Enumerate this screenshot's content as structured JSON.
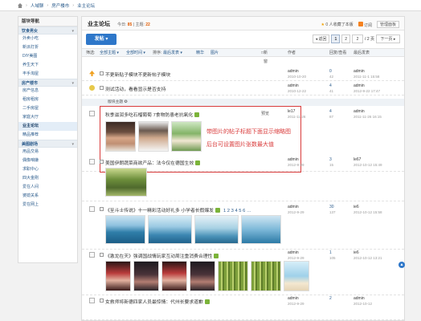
{
  "breadcrumb": {
    "items": [
      "人域聊",
      "房产楼市",
      "业主论坛"
    ]
  },
  "sidebar": {
    "title": "版块导航",
    "groups": [
      {
        "label": "饮食男女",
        "items": [
          "外卖小吃",
          "新派打折",
          "DIY美图",
          "养生天下",
          "丰手淘屋"
        ]
      },
      {
        "label": "房产楼市",
        "items": [
          "房产信息",
          "租房租房",
          "二手房屋",
          "家庭大厅",
          "业主论坛",
          "精品推荐"
        ]
      },
      {
        "label": "美图剧场",
        "items": [
          "用品交易",
          "偶像咱嫌",
          "求职中心",
          "四大金刚",
          "爱在人间",
          "婆媳关系",
          "爱在网上"
        ]
      }
    ],
    "active_item": "业主论坛"
  },
  "header": {
    "forum_title": "业主论坛",
    "today_label": "今日:",
    "today_value": "85",
    "topics_label": "主题:",
    "topics_value": "22",
    "fav_text": "0 人收藏了本版",
    "rss_text": "订阅",
    "manage_text": "管理面板"
  },
  "toolbar": {
    "post_button": "发帖 ▾",
    "pager": {
      "prev": "◂ 返回",
      "p1": "1",
      "p2": "2",
      "input": "2",
      "total": "/ 2 页",
      "next": "下一页 ▸"
    }
  },
  "filter": {
    "filter_label": "筛选:",
    "all_topics": "全部主题 ▾",
    "all_time": "全部时间 ▾",
    "sort_label": "排序:",
    "latest_post": "最后发表 ▾",
    "elite": "精华",
    "images": "图片",
    "new_window": "新窗",
    "col_author": "作者",
    "col_replies": "回复/查看",
    "col_last": "最后发表"
  },
  "section_label": "版块主题 ✪",
  "threads": [
    {
      "title": "不更新贴子模块不更新帖子模块",
      "author": "admin",
      "date": "2010-10-20",
      "replies": "0",
      "views": "42",
      "last_user": "admin",
      "last_date": "2011-11-1 15:58"
    },
    {
      "title": "测试活动，看看显示是否支持",
      "author": "admin",
      "date": "2010-12-22",
      "replies": "4",
      "views": "41",
      "last_user": "admin",
      "last_date": "2012-9-22 17:47"
    },
    {
      "title": "秋季滋润多吃石榴葡萄 7食物防患老抗氧化",
      "preview": "预览",
      "author": "le17",
      "date": "2011-11-26",
      "replies": "4",
      "views": "87",
      "last_user": "admin",
      "last_date": "2011-11-26 16:15"
    },
    {
      "title": "美国伊朗蔬菜商欲产品：法今仅在德国生效",
      "author": "admin",
      "date": "2012-9-29",
      "replies": "3",
      "views": "15",
      "last_user": "le67",
      "last_date": "2012-10-12 15:49"
    },
    {
      "title": "《至斗士传说》十一精彩活动好礼多 小学者长假爆发",
      "pages": "1 2 3 4 5 6 …",
      "author": "admin",
      "date": "2012-9-29",
      "replies": "30",
      "views": "137",
      "last_user": "ie6",
      "last_date": "2012-10-12 15:58"
    },
    {
      "title": "《激龙在天》强调国战情玩家互动周注重消费合理性",
      "author": "admin",
      "date": "2012-9-29",
      "replies": "1",
      "views": "105",
      "last_user": "ie6",
      "last_date": "2012-10-12 13:21"
    },
    {
      "title": "女救师将新德四家人员最惊情：代州长要求道歉",
      "author": "admin",
      "date": "2012-9-29",
      "replies": "2",
      "views": "",
      "last_user": "admin",
      "last_date": "2012-10-12"
    }
  ],
  "annotation": {
    "line1": "带图片的帖子标题下面显示缩略图",
    "line2": "后台可设置图片张数最大值"
  },
  "colors": {
    "accent": "#2e77c9",
    "annotation": "#d93b3b",
    "link": "#2a5b8c"
  }
}
